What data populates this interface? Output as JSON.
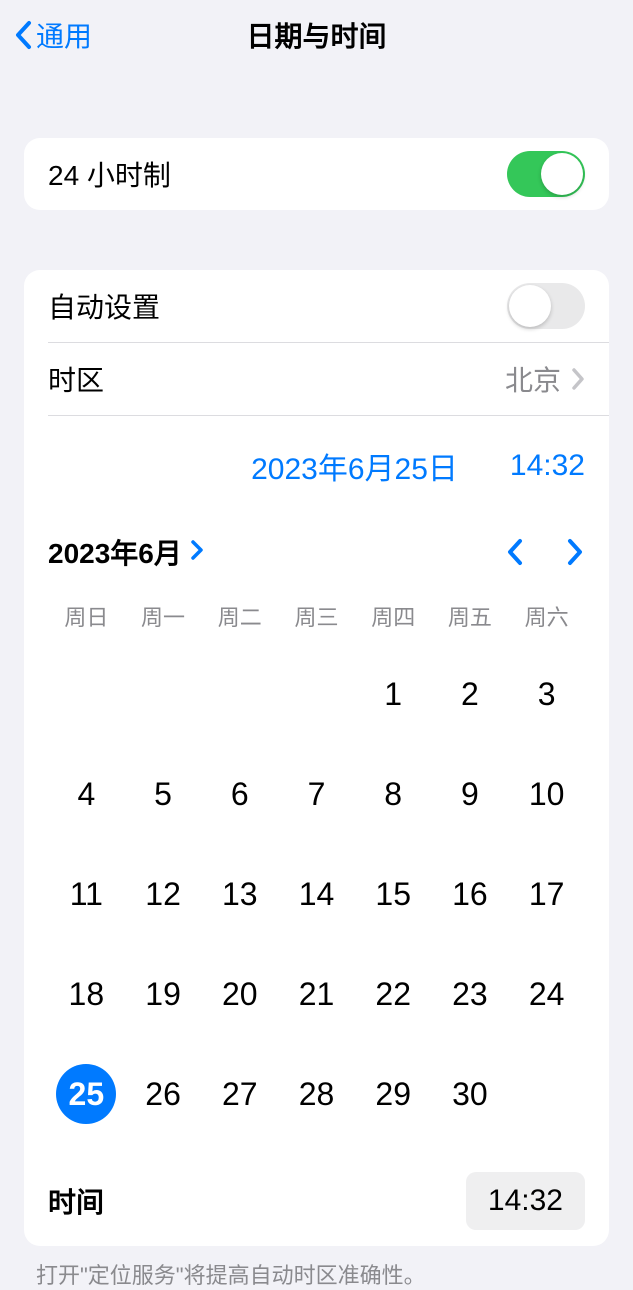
{
  "header": {
    "back_label": "通用",
    "title": "日期与时间"
  },
  "settings": {
    "clock24_label": "24 小时制",
    "clock24_on": true,
    "autoset_label": "自动设置",
    "autoset_on": false,
    "timezone_label": "时区",
    "timezone_value": "北京"
  },
  "datetime": {
    "current_date": "2023年6月25日",
    "current_time": "14:32"
  },
  "calendar": {
    "month_label": "2023年6月",
    "weekdays": [
      "周日",
      "周一",
      "周二",
      "周三",
      "周四",
      "周五",
      "周六"
    ],
    "first_weekday_index": 4,
    "days_in_month": 30,
    "selected_day": 25
  },
  "time_row": {
    "label": "时间",
    "value": "14:32"
  },
  "footnote": "打开\"定位服务\"将提高自动时区准确性。"
}
